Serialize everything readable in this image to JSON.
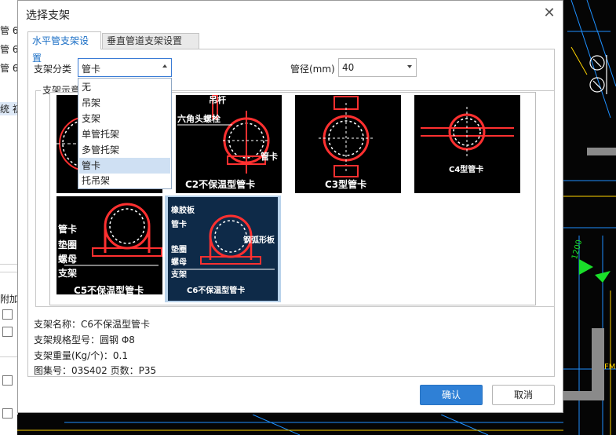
{
  "dialog": {
    "title": "选择支架"
  },
  "tabs": [
    {
      "label": "水平管支架设置",
      "active": true
    },
    {
      "label": "垂直管道支架设置",
      "active": false
    }
  ],
  "form": {
    "category_label": "支架分类",
    "category_value": "管卡",
    "diameter_label": "管径(mm)",
    "diameter_value": "40",
    "group_label": "支架示意"
  },
  "dropdown_options": [
    "无",
    "吊架",
    "支架",
    "单管托架",
    "多管托架",
    "管卡",
    "托吊架"
  ],
  "dropdown_selected": "管卡",
  "thumbnails": [
    {
      "id": "c1",
      "labels": []
    },
    {
      "id": "c2",
      "labels": [
        "吊杆",
        "六角头螺栓",
        "管卡",
        "C2不保温型管卡"
      ]
    },
    {
      "id": "c3",
      "labels": [
        "C3型管卡"
      ]
    },
    {
      "id": "c4",
      "labels": [
        "C4型管卡"
      ]
    },
    {
      "id": "c5",
      "labels": [
        "管卡",
        "垫圈",
        "螺母",
        "支架",
        "C5不保温型管卡"
      ]
    },
    {
      "id": "c6",
      "labels": [
        "橡胶板",
        "管卡",
        "钢弧形板",
        "垫圈",
        "螺母",
        "支架",
        "C6不保温型管卡"
      ],
      "selected": true
    }
  ],
  "info": {
    "name": "支架名称：C6不保温型管卡",
    "spec": "支架规格型号：圆钢 Φ8",
    "weight": "支架重量(Kg/个)：0.1",
    "atlas": "图集号：03S402   页数：P35"
  },
  "buttons": {
    "ok": "确认",
    "cancel": "取消"
  },
  "background": {
    "left_texts": [
      "管 6",
      "管 6",
      "管 6",
      "统 初",
      "附加"
    ],
    "cad_texts": [
      "1200",
      "FMM"
    ]
  }
}
